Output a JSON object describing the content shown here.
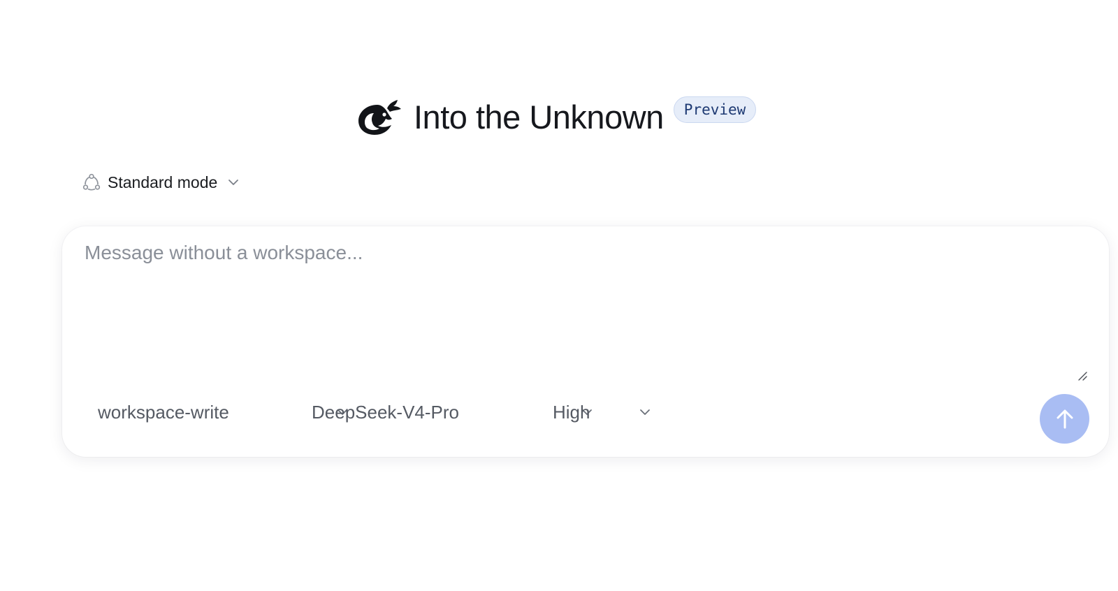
{
  "header": {
    "title": "Into the Unknown",
    "badge": "Preview",
    "logo_icon": "whale-logo-icon"
  },
  "mode_selector": {
    "label": "Standard mode",
    "icon": "nodes-cycle-icon"
  },
  "composer": {
    "placeholder": "Message without a workspace...",
    "value": "",
    "selectors": {
      "sandbox": "workspace-write",
      "model": "DeepSeek-V4-Pro",
      "effort": "High"
    },
    "send_icon": "arrow-up-icon"
  },
  "colors": {
    "badge_bg": "#e6edf9",
    "badge_text": "#1e3a73",
    "send_button": "#a9bdf3",
    "placeholder": "#8a8f98"
  }
}
